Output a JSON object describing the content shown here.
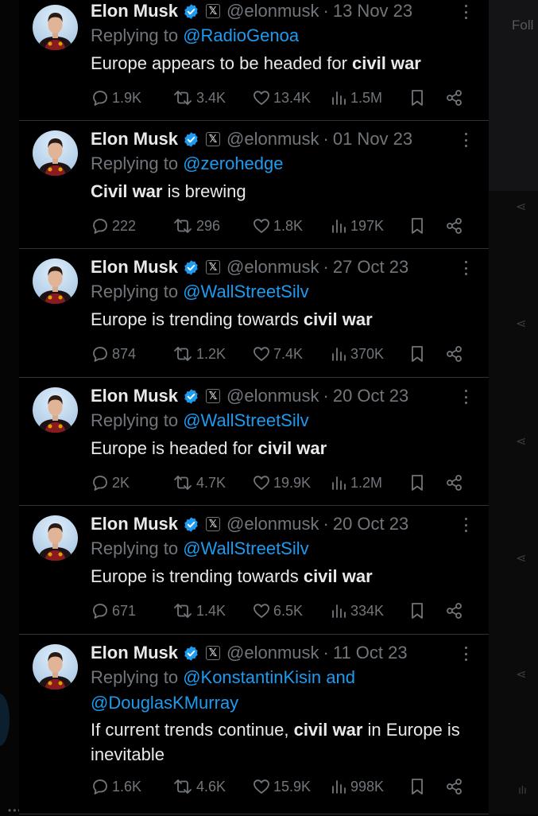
{
  "background": {
    "follow_label": "Foll",
    "bottom_dots": "•••"
  },
  "colors": {
    "link": "#1d9bf0",
    "verified": "#1d9bf0",
    "muted": "#71767b",
    "text": "#e7e9ea",
    "divider": "#2f3336"
  },
  "replying_to_label": "Replying to",
  "tweets": [
    {
      "name": "Elon Musk",
      "handle": "@elonmusk",
      "date": "13 Nov 23",
      "replying_to": "@RadioGenoa",
      "replying_to_2": "",
      "and_word": "",
      "text_before": "Europe appears to be headed for ",
      "text_bold": "civil war",
      "text_after": "",
      "replies": "1.9K",
      "reposts": "3.4K",
      "likes": "13.4K",
      "views": "1.5M"
    },
    {
      "name": "Elon Musk",
      "handle": "@elonmusk",
      "date": "01 Nov 23",
      "replying_to": "@zerohedge",
      "replying_to_2": "",
      "and_word": "",
      "text_before": "",
      "text_bold": "Civil war",
      "text_after": " is brewing",
      "replies": "222",
      "reposts": "296",
      "likes": "1.8K",
      "views": "197K"
    },
    {
      "name": "Elon Musk",
      "handle": "@elonmusk",
      "date": "27 Oct 23",
      "replying_to": "@WallStreetSilv",
      "replying_to_2": "",
      "and_word": "",
      "text_before": "Europe is trending towards ",
      "text_bold": "civil war",
      "text_after": "",
      "replies": "874",
      "reposts": "1.2K",
      "likes": "7.4K",
      "views": "370K"
    },
    {
      "name": "Elon Musk",
      "handle": "@elonmusk",
      "date": "20 Oct 23",
      "replying_to": "@WallStreetSilv",
      "replying_to_2": "",
      "and_word": "",
      "text_before": "Europe is headed for ",
      "text_bold": "civil war",
      "text_after": "",
      "replies": "2K",
      "reposts": "4.7K",
      "likes": "19.9K",
      "views": "1.2M"
    },
    {
      "name": "Elon Musk",
      "handle": "@elonmusk",
      "date": "20 Oct 23",
      "replying_to": "@WallStreetSilv",
      "replying_to_2": "",
      "and_word": "",
      "text_before": "Europe is trending towards ",
      "text_bold": "civil war",
      "text_after": "",
      "replies": "671",
      "reposts": "1.4K",
      "likes": "6.5K",
      "views": "334K"
    },
    {
      "name": "Elon Musk",
      "handle": "@elonmusk",
      "date": "11 Oct 23",
      "replying_to": "@KonstantinKisin",
      "replying_to_2": "@DouglasKMurray",
      "and_word": "and",
      "text_before": "If current trends continue, ",
      "text_bold": "civil war",
      "text_after": " in Europe is inevitable",
      "replies": "1.6K",
      "reposts": "4.6K",
      "likes": "15.9K",
      "views": "998K"
    }
  ]
}
